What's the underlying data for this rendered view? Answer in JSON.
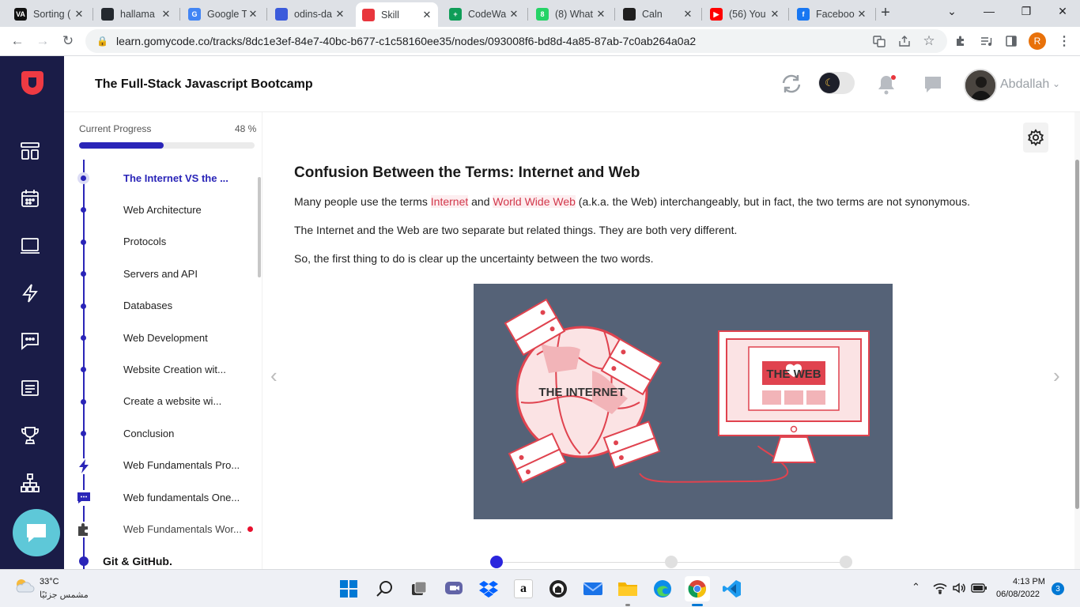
{
  "browser": {
    "tabs": [
      {
        "title": "Sorting (",
        "favicon": "va-icon",
        "color": "#111111",
        "glyph": "VA"
      },
      {
        "title": "hallama",
        "favicon": "github-icon",
        "color": "#24292f",
        "glyph": ""
      },
      {
        "title": "Google T",
        "favicon": "google-translate-icon",
        "color": "#4285f4",
        "glyph": "G"
      },
      {
        "title": "odins-da",
        "favicon": "codepen-icon",
        "color": "#3b5bdb",
        "glyph": ""
      },
      {
        "title": "Skill",
        "favicon": "gomycode-icon",
        "color": "#e8363d",
        "glyph": ""
      },
      {
        "title": "CodeWa",
        "favicon": "sheets-icon",
        "color": "#0f9d58",
        "glyph": "+"
      },
      {
        "title": "(8) What",
        "favicon": "whatsapp-icon",
        "color": "#25d366",
        "glyph": "8"
      },
      {
        "title": "Caln",
        "favicon": "calm-icon",
        "color": "#1f1f1f",
        "glyph": ""
      },
      {
        "title": "(56) You",
        "favicon": "youtube-icon",
        "color": "#ff0000",
        "glyph": "▶"
      },
      {
        "title": "Faceboo",
        "favicon": "facebook-icon",
        "color": "#1877f2",
        "glyph": "f"
      }
    ],
    "new_tab": "+",
    "url": "learn.gomycode.co/tracks/8dc1e3ef-84e7-40bc-b677-c1c58160ee35/nodes/093008f6-bd8d-4a85-87ab-7c0ab264a0a2",
    "profile_initial": "R"
  },
  "app": {
    "course_title": "The Full-Stack Javascript Bootcamp",
    "user_name": "Abdallah",
    "brand_color": "#ee3a43",
    "rail_color": "#1a1c47",
    "accent": "#2a25b8"
  },
  "sidebar": {
    "progress_label": "Current Progress",
    "progress_value": "48 %",
    "progress_fraction": 0.48,
    "nodes": [
      {
        "label": "The Internet VS the ...",
        "type": "active"
      },
      {
        "label": "Web Architecture",
        "type": "dot"
      },
      {
        "label": "Protocols",
        "type": "dot"
      },
      {
        "label": "Servers and API",
        "type": "dot"
      },
      {
        "label": "Databases",
        "type": "dot"
      },
      {
        "label": "Web Development",
        "type": "dot"
      },
      {
        "label": "Website Creation wit...",
        "type": "dot"
      },
      {
        "label": "Create a website wi...",
        "type": "dot"
      },
      {
        "label": "Conclusion",
        "type": "dot"
      },
      {
        "label": "Web Fundamentals Pro...",
        "type": "bolt-icon"
      },
      {
        "label": "Web fundamentals One...",
        "type": "chat-icon"
      },
      {
        "label": "Web Fundamentals Wor...",
        "type": "puzzle-icon"
      }
    ],
    "next_section": "Git & GitHub."
  },
  "content": {
    "heading": "Confusion Between the Terms: Internet and Web",
    "p1_before": "Many people use the terms ",
    "p1_term1": "Internet",
    "p1_mid": " and ",
    "p1_term2": "World Wide Web",
    "p1_after": " (a.k.a. the Web) interchangeably, but in fact, the two terms are not synonymous.",
    "p2": "The Internet and the Web are two separate but related things. They are both very different.",
    "p3": "So, the first thing to do is clear up the uncertainty between the two words.",
    "illustration": {
      "left_label": "THE INTERNET",
      "right_label": "THE WEB",
      "bg": "#556277"
    }
  },
  "taskbar": {
    "temperature": "33°C",
    "weather": "مشمس جزئيًا",
    "time": "4:13 PM",
    "date": "06/08/2022",
    "notifications": "3"
  }
}
